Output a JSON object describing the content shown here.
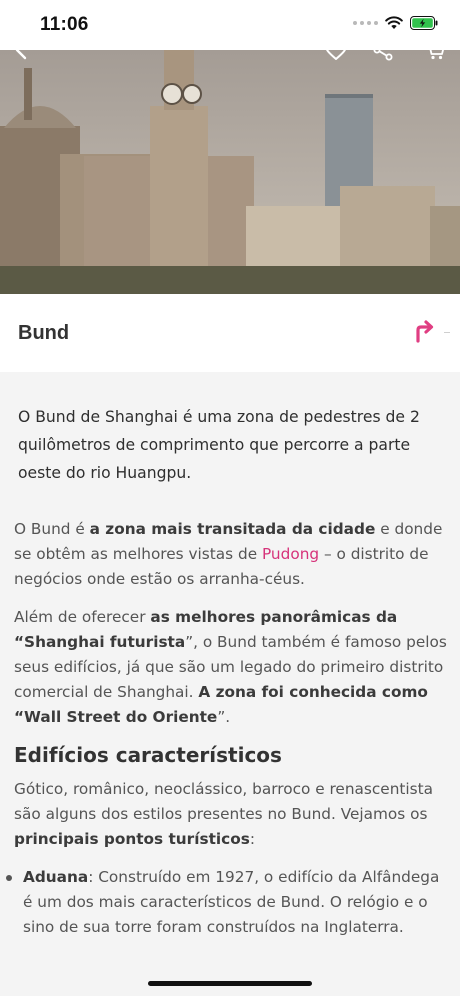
{
  "status_bar": {
    "time": "11:06",
    "icons": [
      "signal-dots",
      "wifi-icon",
      "battery-charging-icon"
    ]
  },
  "nav": {
    "icons": [
      "back-icon",
      "heart-icon",
      "share-icon",
      "cart-icon"
    ]
  },
  "place": {
    "title": "Bund",
    "route_icon": "turn-right-arrow-icon",
    "accent_color": "#e03e82"
  },
  "summary": "O Bund de Shanghai é uma zona de pedestres de 2 quilômetros de comprimento que percorre a parte oeste do rio Huangpu.",
  "para1": {
    "t1": "O Bund é ",
    "b1": "a zona mais transitada da cidade",
    "t2": " e donde se obtêm as melhores vistas de ",
    "link": "Pudong",
    "t3": " – o distrito de negócios onde estão os arranha-céus."
  },
  "para2": {
    "t1": "Além de oferecer ",
    "b1": "as melhores panorâmicas da “Shanghai futurista",
    "t2": "”, o Bund também é famoso pelos seus edifícios, já que são um legado do primeiro distrito comercial de Shanghai. ",
    "b2": "A zona foi conhecida como “Wall Street do Oriente",
    "t3": "”."
  },
  "section": {
    "title": "Edifícios característicos"
  },
  "para3": {
    "t1": "Gótico, românico, neoclássico, barroco e renascentista são alguns dos estilos presentes no Bund. Vejamos os ",
    "b1": "principais pontos turísticos",
    "t2": ":"
  },
  "bullet1": {
    "b1": "Aduana",
    "t1": ": Construído em 1927, o edifício da Alfândega é um dos mais característicos de Bund. O relógio e o sino de sua torre foram construídos na Inglaterra."
  }
}
